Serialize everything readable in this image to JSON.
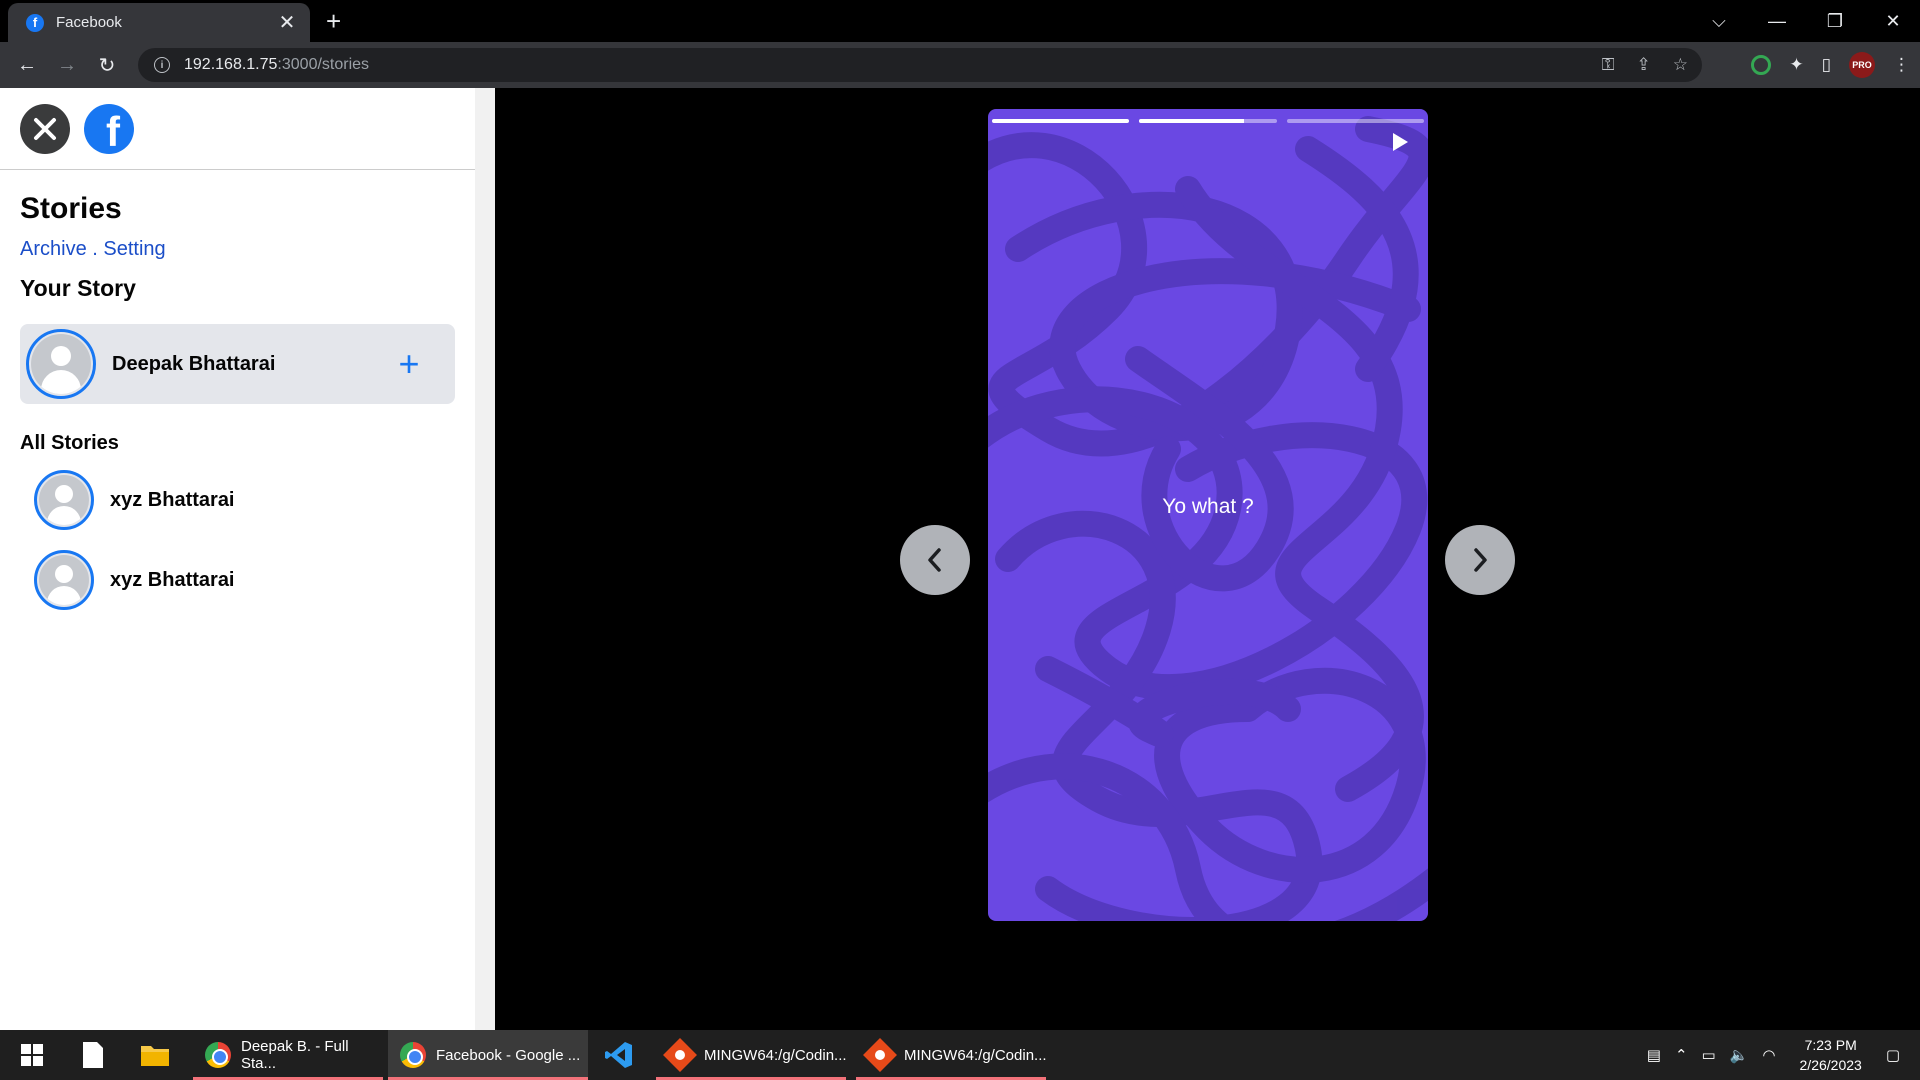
{
  "browser": {
    "tab_title": "Facebook",
    "tab_favicon": "f",
    "url_host": "192.168.1.75",
    "url_path": ":3000/stories",
    "profile_badge": "PRO"
  },
  "sidebar": {
    "logo_letter": "f",
    "title": "Stories",
    "links_archive": "Archive",
    "links_separator": " . ",
    "links_setting": "Setting",
    "your_story_heading": "Your Story",
    "your_story_name": "Deepak Bhattarai",
    "add_label": "+",
    "all_stories_heading": "All Stories",
    "stories": [
      {
        "name": "xyz Bhattarai"
      },
      {
        "name": "xyz Bhattarai"
      }
    ]
  },
  "viewer": {
    "text": "Yo what ?",
    "background_color": "#6a48e3",
    "progress": [
      1.0,
      0.76,
      0.0
    ]
  },
  "taskbar": {
    "items": [
      {
        "label": "Deepak B. - Full Sta...",
        "icon": "chrome-icon"
      },
      {
        "label": "Facebook - Google ...",
        "icon": "chrome-icon"
      },
      {
        "label": "MINGW64:/g/Codin...",
        "icon": "git-bash-icon"
      },
      {
        "label": "MINGW64:/g/Codin...",
        "icon": "git-bash-icon"
      }
    ],
    "time": "7:23 PM",
    "date": "2/26/2023"
  }
}
